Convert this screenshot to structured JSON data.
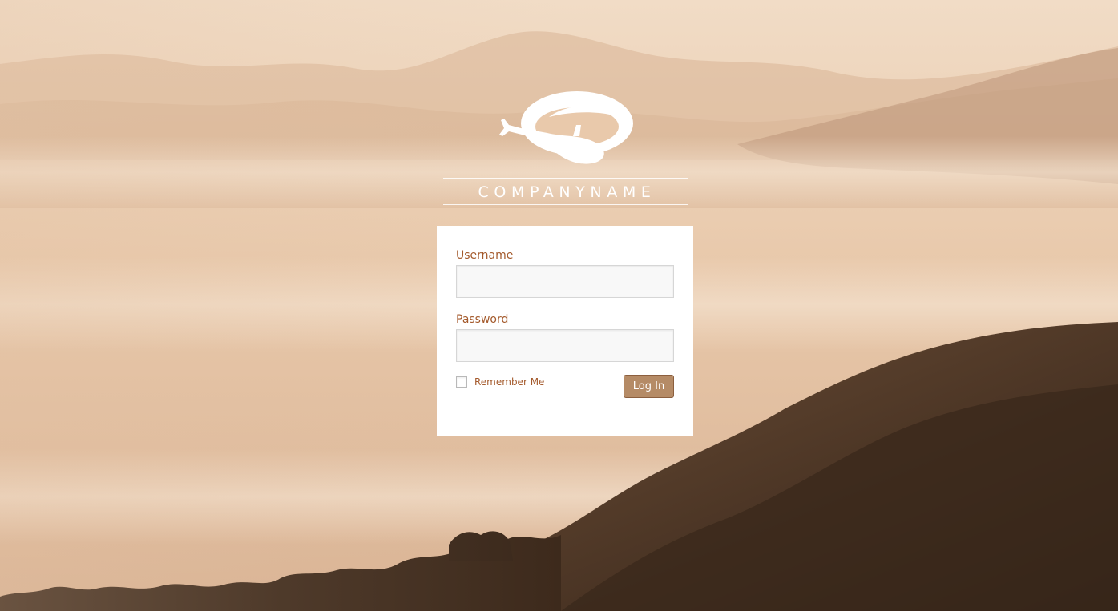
{
  "logo": {
    "company_name": "COMPANYNAME",
    "icon": "helicopter-logo-icon"
  },
  "login_form": {
    "username_label": "Username",
    "username_value": "",
    "password_label": "Password",
    "password_value": "",
    "remember_label": "Remember Me",
    "remember_checked": false,
    "submit_label": "Log In"
  },
  "colors": {
    "label": "#a45a2c",
    "button": "#b58b66",
    "background_sky": "#e3c2a4",
    "hills": "#4a3424"
  }
}
